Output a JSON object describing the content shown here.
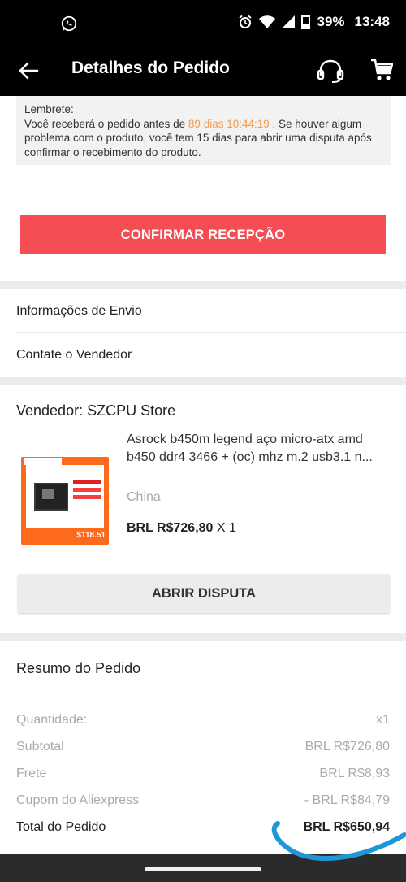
{
  "status_bar": {
    "battery": "39%",
    "time": "13:48",
    "icons": [
      "whatsapp-icon",
      "alarm-icon",
      "wifi-icon",
      "signal-icon",
      "battery-icon"
    ]
  },
  "app_bar": {
    "title": "Detalhes do Pedido",
    "icons": [
      "back-arrow-icon",
      "headset-icon",
      "cart-icon"
    ]
  },
  "reminder": {
    "label": "Lembrete:",
    "text_before": "Você receberá o pedido antes de",
    "countdown": "89 dias 10:44:19",
    "text_after": ". Se houver algum problema com o produto, você tem 15 dias para abrir uma disputa após confirmar o recebimento do produto."
  },
  "confirm_button": "CONFIRMAR RECEPÇÃO",
  "links": {
    "shipping_info": "Informações de Envio",
    "contact_seller": "Contate o Vendedor"
  },
  "seller": {
    "name": "Vendedor: SZCPU Store"
  },
  "product": {
    "title": "Asrock b450m legend aço micro-atx amd b450 ddr4 3466 + (oc) mhz m.2 usb3.1 n...",
    "origin": "China",
    "price": "BRL R$726,80",
    "quantity": "X 1",
    "thumbnail_price": "$118.51"
  },
  "dispute_button": "ABRIR DISPUTA",
  "summary": {
    "title": "Resumo do Pedido",
    "rows": [
      {
        "label": "Quantidade:",
        "value": "x1"
      },
      {
        "label": "Subtotal",
        "value": "BRL R$726,80"
      },
      {
        "label": "Frete",
        "value": "BRL R$8,93"
      },
      {
        "label": "Cupom do Aliexpress",
        "value": "- BRL R$84,79"
      }
    ],
    "total_label": "Total do Pedido",
    "total_value": "BRL R$650,94"
  },
  "colors": {
    "accent_red": "#f44d54",
    "countdown_orange": "#f39a4d",
    "annotation_blue": "#1f97d6"
  }
}
